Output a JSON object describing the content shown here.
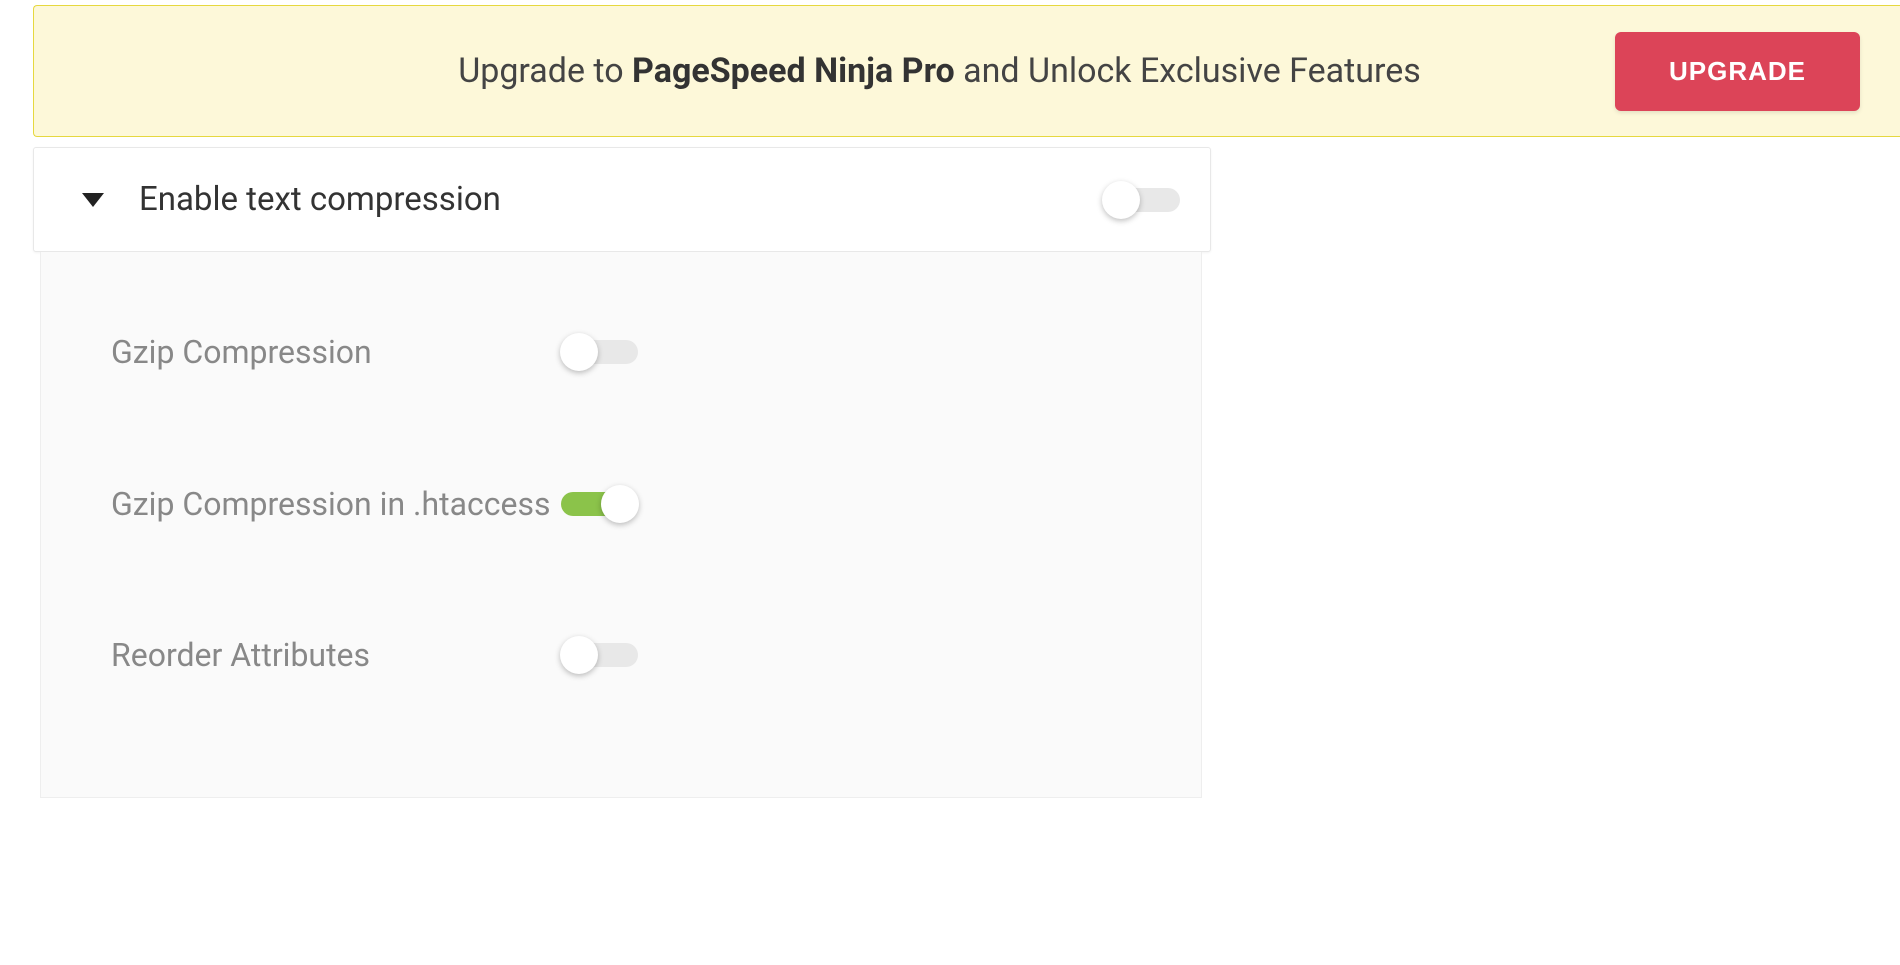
{
  "banner": {
    "text_prefix": "Upgrade to ",
    "text_bold": "PageSpeed Ninja Pro",
    "text_suffix": " and Unlock Exclusive Features",
    "button_label": "UPGRADE"
  },
  "panel": {
    "title": "Enable text compression",
    "main_toggle": false
  },
  "settings": [
    {
      "label": "Gzip Compression",
      "enabled": false
    },
    {
      "label": "Gzip Compression in .htaccess",
      "enabled": true
    },
    {
      "label": "Reorder Attributes",
      "enabled": false
    }
  ]
}
